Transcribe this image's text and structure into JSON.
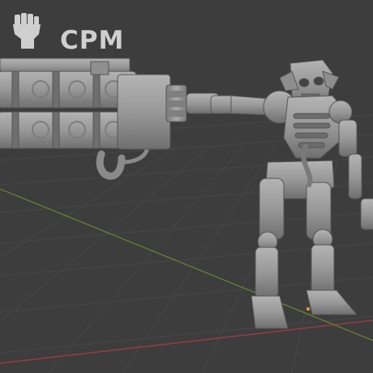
{
  "viewport": {
    "background_color": "#3d3d3d",
    "grid_color": "#4a4a4a",
    "x_axis_color": "#9a3a46",
    "y_axis_color": "#6a8a2c",
    "model_color": "#9c9c9c"
  },
  "watermark": {
    "text": "CPM",
    "icon": "raised-fist-icon",
    "color": "#cfcfcf"
  }
}
